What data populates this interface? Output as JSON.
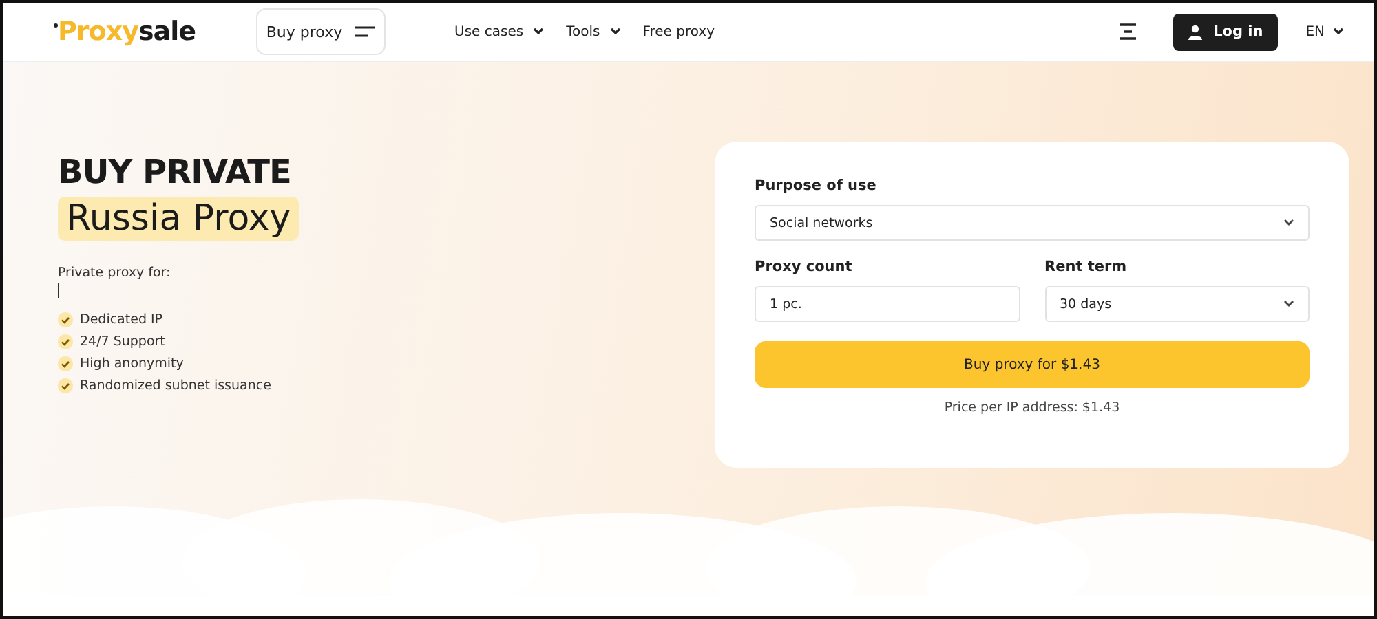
{
  "header": {
    "logo": {
      "accent": "Proxy",
      "rest": "sale"
    },
    "buy_button": "Buy proxy",
    "nav": [
      {
        "label": "Use cases",
        "dropdown": true
      },
      {
        "label": "Tools",
        "dropdown": true
      },
      {
        "label": "Free proxy",
        "dropdown": false
      }
    ],
    "login": "Log in",
    "language": "EN"
  },
  "hero": {
    "title": "BUY PRIVATE",
    "highlight": "Russia Proxy",
    "intro": "Private proxy for:",
    "features": [
      "Dedicated IP",
      "24/7 Support",
      "High anonymity",
      "Randomized subnet issuance"
    ]
  },
  "form": {
    "purpose_label": "Purpose of use",
    "purpose_value": "Social networks",
    "count_label": "Proxy count",
    "count_value": "1 pc.",
    "term_label": "Rent term",
    "term_value": "30 days",
    "buy_button": "Buy proxy for $1.43",
    "price_note": "Price per IP address: $1.43"
  }
}
